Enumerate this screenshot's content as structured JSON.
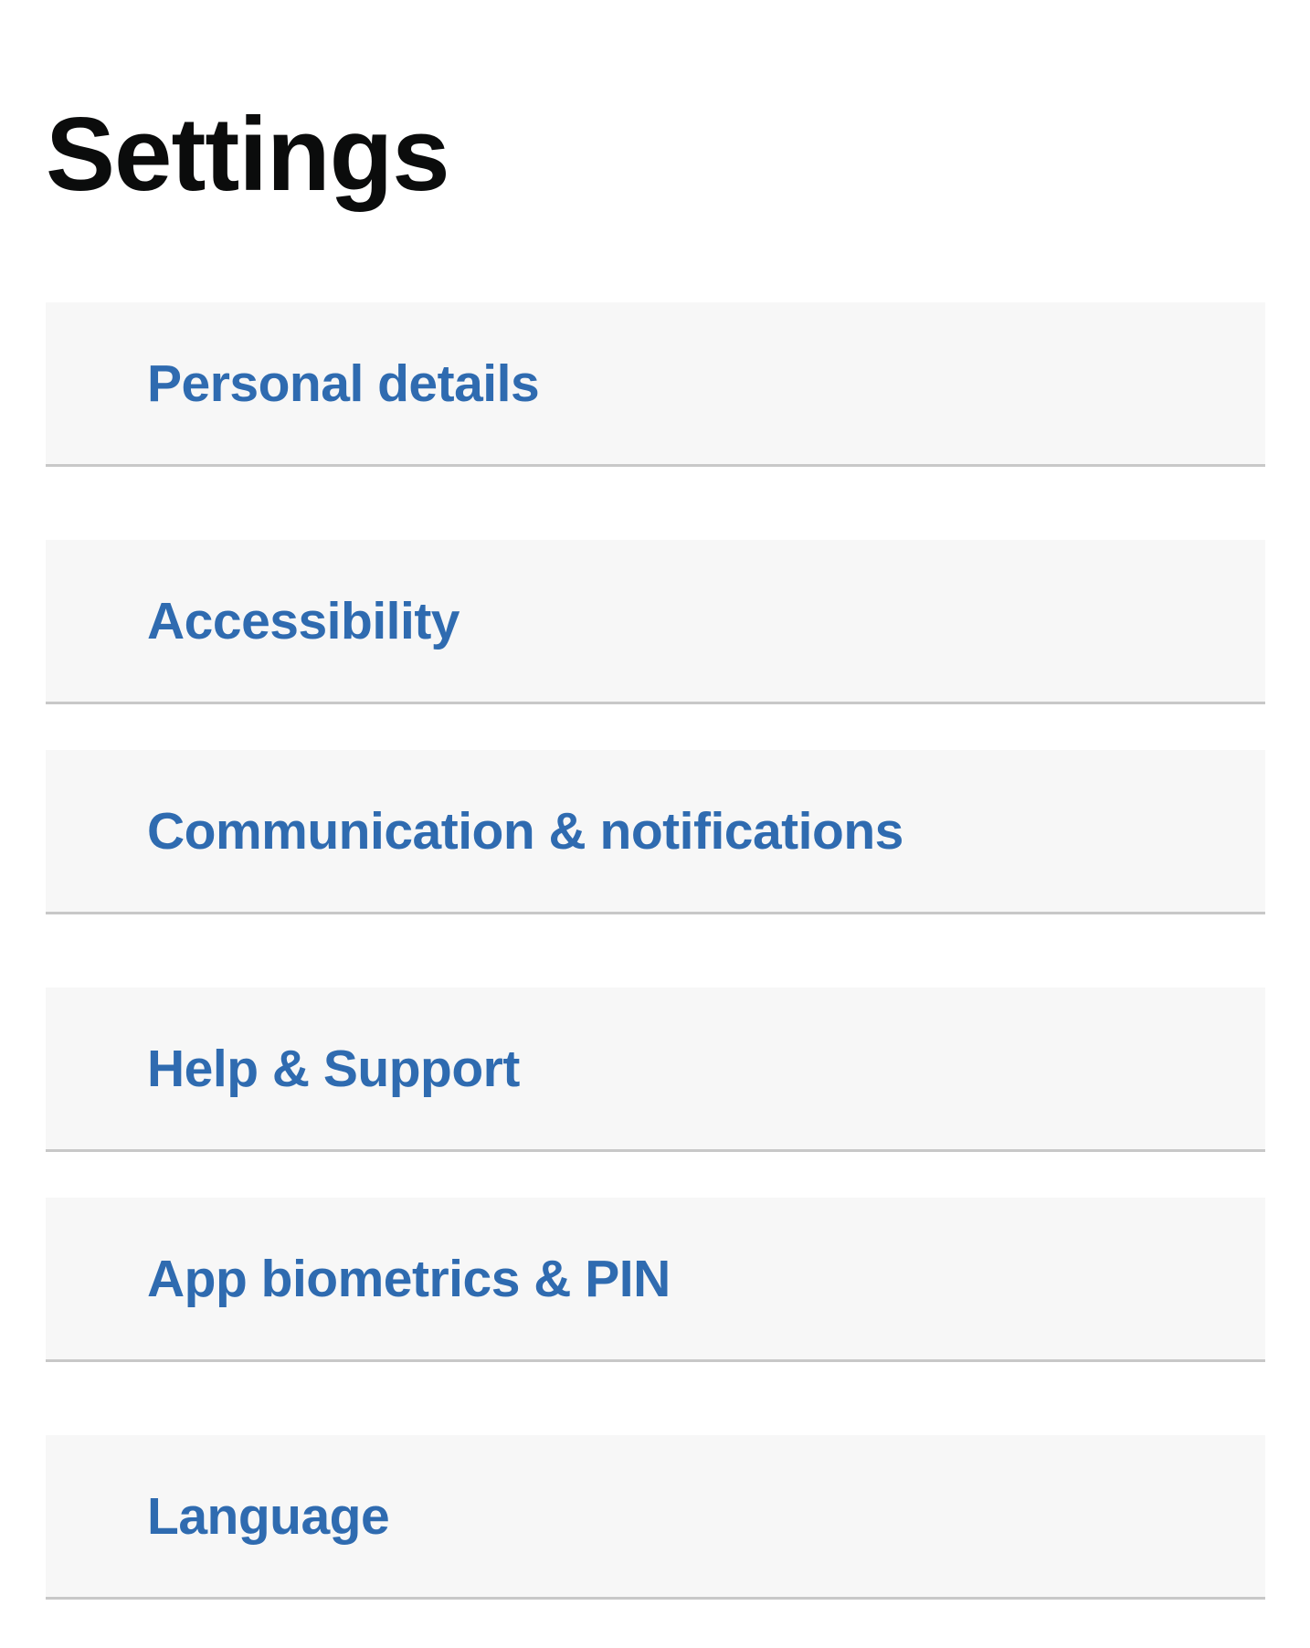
{
  "page": {
    "title": "Settings"
  },
  "menu": {
    "items": [
      {
        "label": "Personal details"
      },
      {
        "label": "Accessibility"
      },
      {
        "label": "Communication & notifications"
      },
      {
        "label": "Help & Support"
      },
      {
        "label": "App biometrics & PIN"
      },
      {
        "label": "Language"
      }
    ]
  },
  "colors": {
    "link": "#2f6bb0",
    "title": "#0b0c0c",
    "item_background": "#f7f7f7",
    "divider": "#c8c8c8"
  }
}
